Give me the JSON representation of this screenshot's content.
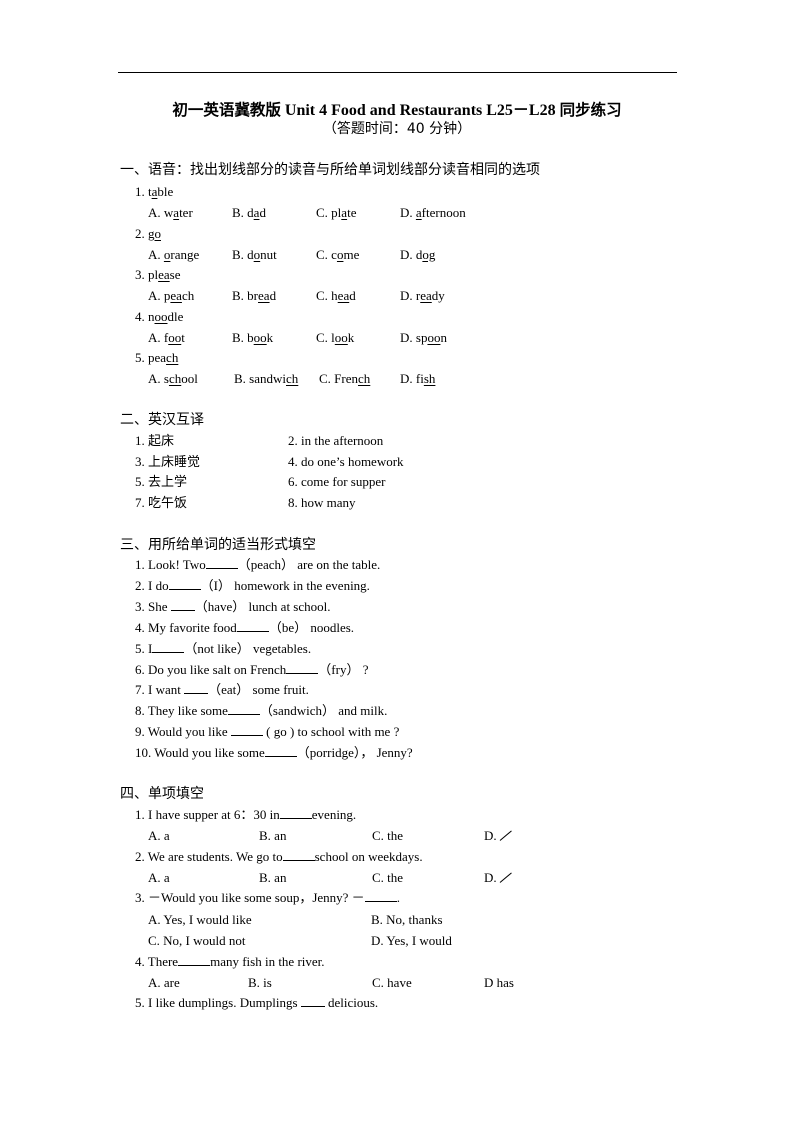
{
  "header": {
    "title_cn_prefix": "初一英语冀教版",
    "title_en": " Unit 4 Food and Restaurants L25－L28 ",
    "title_cn_suffix": "同步练习",
    "subtitle": "（答题时间：40 分钟）"
  },
  "section1": {
    "heading": "一、语音：找出划线部分的读音与所给单词划线部分读音相同的选项",
    "questions": [
      {
        "num": "1. ",
        "word": [
          "t",
          "a",
          "ble"
        ],
        "options": [
          {
            "label": "A. ",
            "parts": [
              "w",
              "a",
              "ter"
            ]
          },
          {
            "label": "B. ",
            "parts": [
              "d",
              "a",
              "d"
            ]
          },
          {
            "label": "C. ",
            "parts": [
              "pl",
              "a",
              "te"
            ]
          },
          {
            "label": "D. ",
            "parts": [
              "",
              "a",
              "fternoon"
            ]
          }
        ]
      },
      {
        "num": "2. ",
        "word": [
          "g",
          "o",
          ""
        ],
        "options": [
          {
            "label": "A. ",
            "parts": [
              "",
              "o",
              "range"
            ]
          },
          {
            "label": "B. ",
            "parts": [
              "d",
              "o",
              "nut"
            ]
          },
          {
            "label": "C. ",
            "parts": [
              "c",
              "o",
              "me"
            ]
          },
          {
            "label": "D. ",
            "parts": [
              "d",
              "og",
              ""
            ]
          }
        ]
      },
      {
        "num": "3. ",
        "word": [
          "pl",
          "ea",
          "se"
        ],
        "options": [
          {
            "label": "A. ",
            "parts": [
              "p",
              "ea",
              "ch"
            ]
          },
          {
            "label": "B. ",
            "parts": [
              "br",
              "ea",
              "d"
            ]
          },
          {
            "label": "C. ",
            "parts": [
              "h",
              "ea",
              "d"
            ]
          },
          {
            "label": "D. ",
            "parts": [
              "r",
              "ea",
              "dy"
            ]
          }
        ]
      },
      {
        "num": "4. ",
        "word": [
          "n",
          "oo",
          "dle"
        ],
        "options": [
          {
            "label": "A. ",
            "parts": [
              "f",
              "oo",
              "t"
            ]
          },
          {
            "label": "B. ",
            "parts": [
              "b",
              "oo",
              "k"
            ]
          },
          {
            "label": "C. ",
            "parts": [
              "l",
              "oo",
              "k"
            ]
          },
          {
            "label": "D. ",
            "parts": [
              "sp",
              "oo",
              "n"
            ]
          }
        ]
      },
      {
        "num": "5. ",
        "word": [
          "pea",
          "ch",
          ""
        ],
        "options": [
          {
            "label": "A. ",
            "parts": [
              "s",
              "ch",
              "ool"
            ]
          },
          {
            "label": "B. ",
            "parts": [
              "sandwi",
              "ch",
              ""
            ]
          },
          {
            "label": "C. ",
            "parts": [
              "Fren",
              "ch",
              ""
            ]
          },
          {
            "label": "D. ",
            "parts": [
              "fi",
              "sh",
              ""
            ]
          }
        ]
      }
    ]
  },
  "section2": {
    "heading": "二、英汉互译",
    "items": [
      {
        "num": "1. ",
        "text": "起床"
      },
      {
        "num": "2. ",
        "text": "in the afternoon"
      },
      {
        "num": "3. ",
        "text": "上床睡觉"
      },
      {
        "num": "4. ",
        "text": "do one’s homework"
      },
      {
        "num": "5. ",
        "text": "去上学"
      },
      {
        "num": "6. ",
        "text": "come for supper"
      },
      {
        "num": "7. ",
        "text": "吃午饭"
      },
      {
        "num": "8. ",
        "text": "how many"
      }
    ]
  },
  "section3": {
    "heading": "三、用所给单词的适当形式填空",
    "items": [
      {
        "before": "1. Look!    Two",
        "hint": "（peach）",
        "after": "are on the table."
      },
      {
        "before": "2. I do",
        "hint": "（I）",
        "after": "homework in the evening."
      },
      {
        "before": "3. She  ",
        "hint": "（have）",
        "after": "lunch at school."
      },
      {
        "before": "4. My favorite food",
        "hint": "（be）",
        "after": "noodles."
      },
      {
        "before": "5. I",
        "hint": "（not like）",
        "after": "vegetables."
      },
      {
        "before": "6. Do you like salt on French",
        "hint": "（fry）",
        "after": "?"
      },
      {
        "before": "7. I want  ",
        "hint": "（eat）",
        "after": "some fruit."
      },
      {
        "before": "8. They like some",
        "hint": "（sandwich）",
        "after": "and milk."
      },
      {
        "before": "9. Would you like ",
        "hint": " ( go ) ",
        "after": "to school with me ?"
      },
      {
        "before": "10. Would you like some",
        "hint": "（porridge），",
        "after": "Jenny?"
      }
    ]
  },
  "section4": {
    "heading": "四、单项填空",
    "questions": [
      {
        "before": "1. I have supper at 6：30 in",
        "after": "evening.",
        "options": [
          "A. a",
          "B. an",
          "C. the",
          "D. "
        ]
      },
      {
        "before": "2. We are students. We go to",
        "after": "school on weekdays.",
        "options": [
          "A. a",
          "B. an",
          "C. the",
          "D. "
        ]
      },
      {
        "before": "3.  －Would you like some soup，Jenny?  －",
        "after": ".",
        "options": [
          "A. Yes, I would like",
          "B. No, thanks",
          "C. No, I would not",
          "D. Yes, I would"
        ]
      },
      {
        "before": "4. There",
        "after": "many fish in the river.",
        "options": [
          "A. are",
          "B. is",
          "C. have",
          "D has"
        ]
      },
      {
        "before": "5. I like dumplings. Dumplings ",
        "after": " delicious.",
        "options": []
      }
    ]
  }
}
